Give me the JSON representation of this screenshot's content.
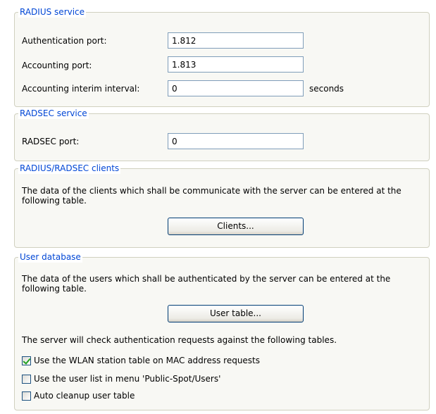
{
  "radius": {
    "legend": "RADIUS service",
    "auth_label": "Authentication port:",
    "auth_value": "1.812",
    "acct_label": "Accounting port:",
    "acct_value": "1.813",
    "interim_label": "Accounting interim interval:",
    "interim_value": "0",
    "interim_unit": "seconds"
  },
  "radsec": {
    "legend": "RADSEC service",
    "port_label": "RADSEC port:",
    "port_value": "0"
  },
  "clients": {
    "legend": "RADIUS/RADSEC clients",
    "description": "The data of the clients which shall be communicate with the server can be entered at the following table.",
    "button_label": "Clients..."
  },
  "userdb": {
    "legend": "User database",
    "description": "The data of the users which shall be authenticated by the server can be entered at the following table.",
    "button_label": "User table...",
    "check_intro": "The server will check authentication requests against the following tables.",
    "options": [
      {
        "label": "Use the WLAN station table on MAC address requests",
        "checked": true
      },
      {
        "label": "Use the user list in menu 'Public-Spot/Users'",
        "checked": false
      },
      {
        "label": "Auto cleanup user table",
        "checked": false
      }
    ]
  }
}
